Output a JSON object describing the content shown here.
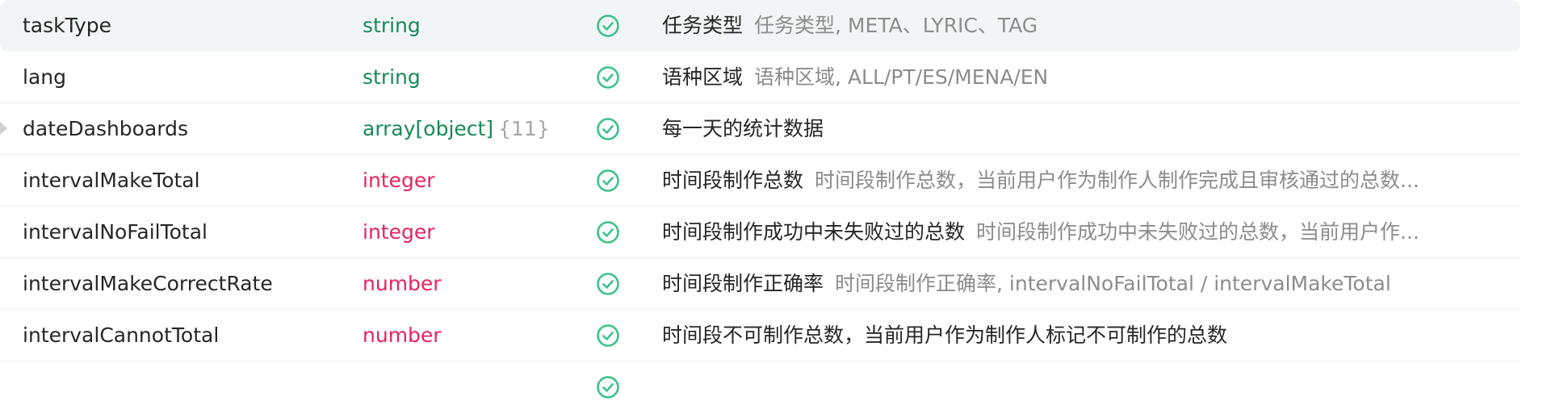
{
  "colors": {
    "string_type": "#178a57",
    "numeric_type": "#e5245f",
    "check_icon": "#3cc28a",
    "row_highlight": "#f2f5f5"
  },
  "rows": [
    {
      "name": "taskType",
      "type": "string",
      "type_count": "",
      "required_icon": "check-circle-icon",
      "title": "任务类型",
      "detail": "任务类型, META、LYRIC、TAG"
    },
    {
      "name": "lang",
      "type": "string",
      "type_count": "",
      "required_icon": "check-circle-icon",
      "title": "语种区域",
      "detail": "语种区域, ALL/PT/ES/MENA/EN"
    },
    {
      "name": "dateDashboards",
      "type": "array[object]",
      "type_count": "{11}",
      "required_icon": "check-circle-icon",
      "title": "每一天的统计数据",
      "detail": ""
    },
    {
      "name": "intervalMakeTotal",
      "type": "integer",
      "type_count": "",
      "required_icon": "check-circle-icon",
      "title": "时间段制作总数",
      "detail": "时间段制作总数，当前用户作为制作人制作完成且审核通过的总数..."
    },
    {
      "name": "intervalNoFailTotal",
      "type": "integer",
      "type_count": "",
      "required_icon": "check-circle-icon",
      "title": "时间段制作成功中未失败过的总数",
      "detail": "时间段制作成功中未失败过的总数，当前用户作..."
    },
    {
      "name": "intervalMakeCorrectRate",
      "type": "number",
      "type_count": "",
      "required_icon": "check-circle-icon",
      "title": "时间段制作正确率",
      "detail": "时间段制作正确率, intervalNoFailTotal / intervalMakeTotal"
    },
    {
      "name": "intervalCannotTotal",
      "type": "number",
      "type_count": "",
      "required_icon": "check-circle-icon",
      "title": "时间段不可制作总数，当前用户作为制作人标记不可制作的总数",
      "detail": ""
    }
  ]
}
